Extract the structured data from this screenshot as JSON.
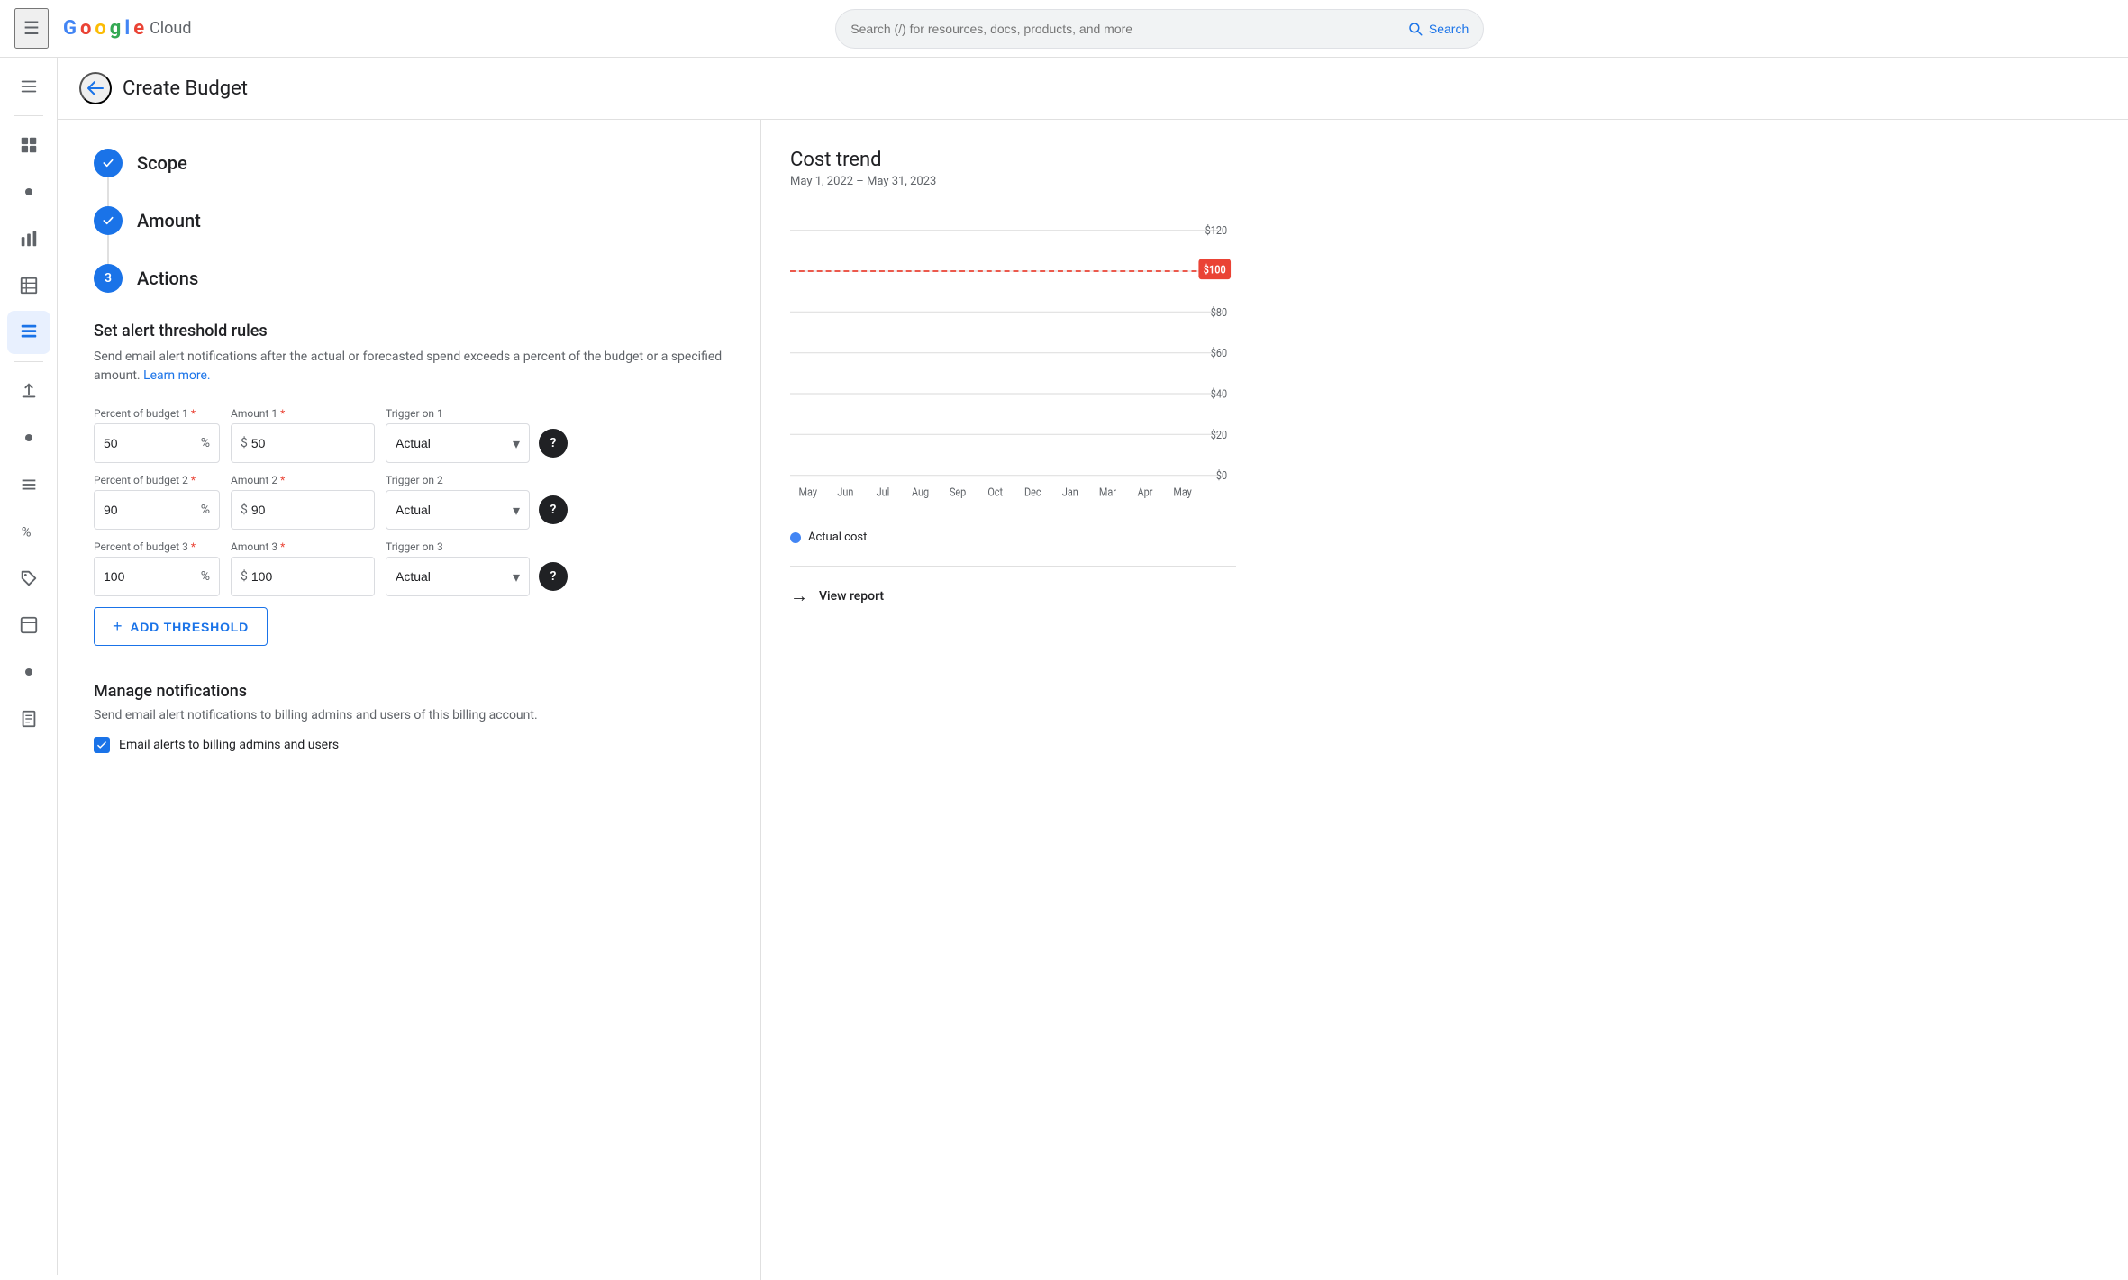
{
  "topbar": {
    "hamburger_label": "☰",
    "logo": {
      "G": "G",
      "o1": "o",
      "o2": "o",
      "g": "g",
      "l": "l",
      "e": "e",
      "cloud": "Cloud"
    },
    "search_placeholder": "Search (/) for resources, docs, products, and more",
    "search_label": "Search"
  },
  "page": {
    "title": "Create Budget",
    "back_label": "←"
  },
  "steps": [
    {
      "id": "scope",
      "label": "Scope",
      "state": "completed",
      "number": "✓"
    },
    {
      "id": "amount",
      "label": "Amount",
      "state": "completed",
      "number": "✓"
    },
    {
      "id": "actions",
      "label": "Actions",
      "state": "active",
      "number": "3"
    }
  ],
  "alert_section": {
    "title": "Set alert threshold rules",
    "description": "Send email alert notifications after the actual or forecasted spend exceeds a percent of the budget or a specified amount.",
    "learn_more": "Learn more."
  },
  "thresholds": [
    {
      "id": 1,
      "percent_label": "Percent of budget 1",
      "percent_value": "50",
      "amount_label": "Amount 1",
      "amount_value": "50",
      "trigger_label": "Trigger on 1",
      "trigger_value": "Actual"
    },
    {
      "id": 2,
      "percent_label": "Percent of budget 2",
      "percent_value": "90",
      "amount_label": "Amount 2",
      "amount_value": "90",
      "trigger_label": "Trigger on 2",
      "trigger_value": "Actual"
    },
    {
      "id": 3,
      "percent_label": "Percent of budget 3",
      "percent_value": "100",
      "amount_label": "Amount 3",
      "amount_value": "100",
      "trigger_label": "Trigger on 3",
      "trigger_value": "Actual"
    }
  ],
  "add_threshold_label": "ADD THRESHOLD",
  "notifications": {
    "title": "Manage notifications",
    "description": "Send email alert notifications to billing admins and users of this billing account.",
    "checkbox_label": "Email alerts to billing admins and users",
    "checked": true
  },
  "cost_trend": {
    "title": "Cost trend",
    "date_range": "May 1, 2022 – May 31, 2023",
    "budget_label": "$100",
    "y_labels": [
      "$120",
      "$100",
      "$80",
      "$60",
      "$40",
      "$20",
      "$0"
    ],
    "x_labels": [
      "May",
      "Jun",
      "Jul",
      "Aug",
      "Sep",
      "Oct",
      "Dec",
      "Jan",
      "Mar",
      "Apr",
      "May"
    ],
    "legend_label": "Actual cost",
    "view_report_label": "View report"
  },
  "sidebar_items": [
    {
      "id": "dashboard",
      "icon": "⊞",
      "active": false
    },
    {
      "id": "divider1",
      "type": "divider"
    },
    {
      "id": "dot1",
      "icon": "•",
      "active": false
    },
    {
      "id": "chart",
      "icon": "▦",
      "active": false
    },
    {
      "id": "table",
      "icon": "☰",
      "active": false
    },
    {
      "id": "reports",
      "icon": "⊟",
      "active": true
    },
    {
      "id": "divider2",
      "type": "divider"
    },
    {
      "id": "upload",
      "icon": "↑",
      "active": false
    },
    {
      "id": "dot2",
      "icon": "•",
      "active": false
    },
    {
      "id": "list",
      "icon": "≡",
      "active": false
    },
    {
      "id": "percent",
      "icon": "%",
      "active": false
    },
    {
      "id": "tag",
      "icon": "⊳",
      "active": false
    },
    {
      "id": "table2",
      "icon": "⊡",
      "active": false
    },
    {
      "id": "dot3",
      "icon": "•",
      "active": false
    },
    {
      "id": "doc",
      "icon": "⊟",
      "active": false
    }
  ]
}
